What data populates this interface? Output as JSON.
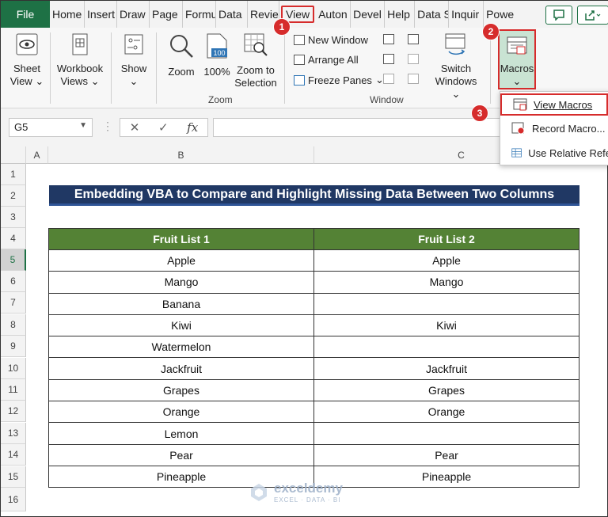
{
  "tabs": {
    "file": "File",
    "items": [
      "Home",
      "Insert",
      "Draw",
      "Page",
      "Formu",
      "Data",
      "Revie",
      "View",
      "Auton",
      "Devel",
      "Help",
      "Data S",
      "Inquir",
      "Powe"
    ],
    "active_index": 7
  },
  "ribbon": {
    "sheet_view": "Sheet\nView",
    "sheet_view_l1": "Sheet",
    "sheet_view_l2": "View",
    "workbook_views_l1": "Workbook",
    "workbook_views_l2": "Views",
    "show": "Show",
    "zoom": "Zoom",
    "zoom100": "100%",
    "zoom_to_selection_l1": "Zoom to",
    "zoom_to_selection_l2": "Selection",
    "zoom_group": "Zoom",
    "new_window": "New Window",
    "arrange_all": "Arrange All",
    "freeze_panes": "Freeze Panes",
    "switch_windows_l1": "Switch",
    "switch_windows_l2": "Windows",
    "window_group": "Window",
    "macros": "Macros",
    "zoom100_icon_text": "100"
  },
  "formula_bar": {
    "name_box": "G5",
    "fx": "fx"
  },
  "columns": [
    "A",
    "B",
    "C"
  ],
  "rows": [
    "1",
    "2",
    "3",
    "4",
    "5",
    "6",
    "7",
    "8",
    "9",
    "10",
    "11",
    "12",
    "13",
    "14",
    "15",
    "16"
  ],
  "selected_row": "5",
  "sheet": {
    "title": "Embedding VBA to Compare and Highlight Missing Data Between Two Columns",
    "headers": [
      "Fruit List 1",
      "Fruit List 2"
    ],
    "rows": [
      [
        "Apple",
        "Apple"
      ],
      [
        "Mango",
        "Mango"
      ],
      [
        "Banana",
        ""
      ],
      [
        "Kiwi",
        "Kiwi"
      ],
      [
        "Watermelon",
        ""
      ],
      [
        "Jackfruit",
        "Jackfruit"
      ],
      [
        "Grapes",
        "Grapes"
      ],
      [
        "Orange",
        "Orange"
      ],
      [
        "Lemon",
        ""
      ],
      [
        "Pear",
        "Pear"
      ],
      [
        "Pineapple",
        "Pineapple"
      ]
    ]
  },
  "macro_menu": {
    "view_macros": "View Macros",
    "record_macro": "Record Macro...",
    "use_relative": "Use Relative Refe"
  },
  "callouts": [
    "1",
    "2",
    "3"
  ],
  "watermark": {
    "title": "exceldemy",
    "subtitle": "EXCEL · DATA · BI"
  },
  "colors": {
    "excel_green": "#1e7145",
    "title_bg": "#203864",
    "header_bg": "#548235",
    "callout_red": "#d62c2c"
  }
}
